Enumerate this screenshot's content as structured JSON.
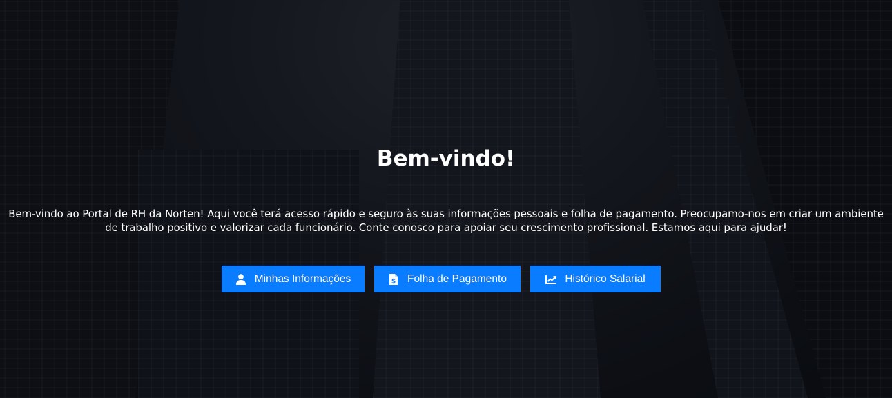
{
  "hero": {
    "title": "Bem-vindo!",
    "intro": "Bem-vindo ao Portal de RH da Norten! Aqui você terá acesso rápido e seguro às suas informações pessoais e folha de pagamento. Preocupamo-nos em criar um ambiente de trabalho positivo e valorizar cada funcionário. Conte conosco para apoiar seu crescimento profissional. Estamos aqui para ajudar!"
  },
  "buttons": [
    {
      "label": "Minhas Informações",
      "icon": "user-icon"
    },
    {
      "label": "Folha de Pagamento",
      "icon": "invoice-dollar-icon"
    },
    {
      "label": "Histórico Salarial",
      "icon": "chart-line-icon"
    }
  ],
  "colors": {
    "button_bg": "#0a7cff",
    "text": "#ffffff"
  }
}
